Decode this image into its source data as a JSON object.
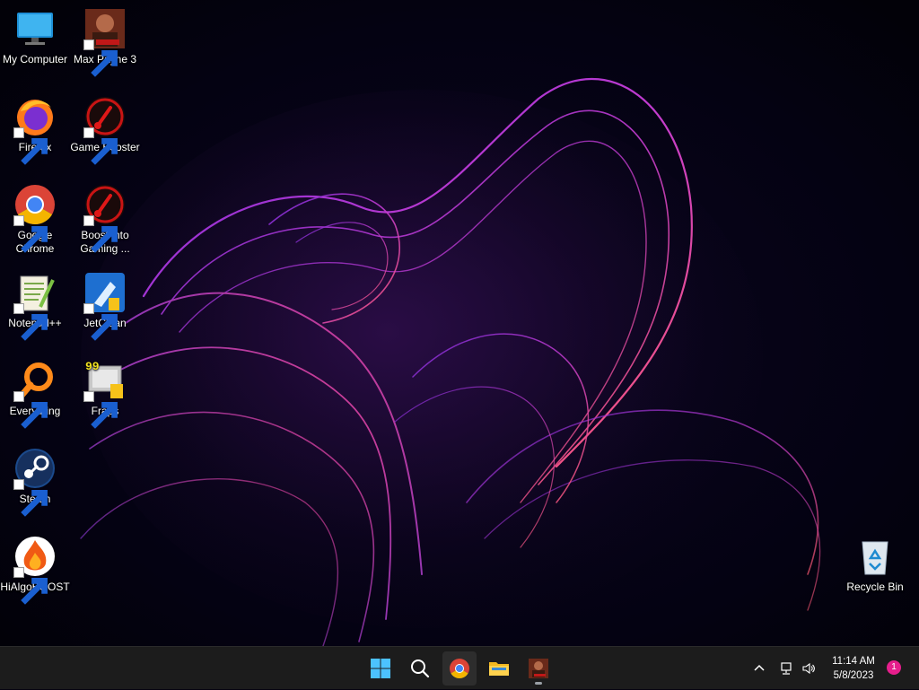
{
  "desktop": {
    "icons": [
      {
        "label": "My Computer",
        "icon": "computer-icon"
      },
      {
        "label": "Max Payne 3",
        "icon": "max-payne-icon"
      },
      {
        "label": "Firefox",
        "icon": "firefox-icon"
      },
      {
        "label": "Game Booster",
        "icon": "game-booster-icon"
      },
      {
        "label": "Google Chrome",
        "icon": "chrome-icon"
      },
      {
        "label": "Boost into Gaming ...",
        "icon": "boost-gaming-icon"
      },
      {
        "label": "Notepad++",
        "icon": "notepadpp-icon"
      },
      {
        "label": "JetClean",
        "icon": "jetclean-icon"
      },
      {
        "label": "Everything",
        "icon": "everything-icon"
      },
      {
        "label": "Fraps",
        "icon": "fraps-icon"
      },
      {
        "label": "Steam",
        "icon": "steam-icon"
      },
      {
        "label": "HiAlgoBOOST",
        "icon": "hialgoboost-icon"
      },
      {
        "label": "Recycle Bin",
        "icon": "recycle-bin-icon"
      }
    ],
    "fraps_badge": "99"
  },
  "taskbar": {
    "apps": [
      {
        "name": "Start",
        "icon": "windows-start-icon"
      },
      {
        "name": "Search",
        "icon": "search-icon"
      },
      {
        "name": "Google Chrome",
        "icon": "chrome-icon"
      },
      {
        "name": "File Explorer",
        "icon": "folder-icon"
      },
      {
        "name": "Max Payne 3",
        "icon": "max-payne-icon"
      }
    ],
    "tray": {
      "time": "11:14 AM",
      "date": "5/8/2023",
      "notification_count": "1"
    }
  },
  "colors": {
    "taskbar_bg": "#1c1c1c",
    "notification_badge": "#e61e8c",
    "wallpaper_accent": "#c23bd0"
  }
}
